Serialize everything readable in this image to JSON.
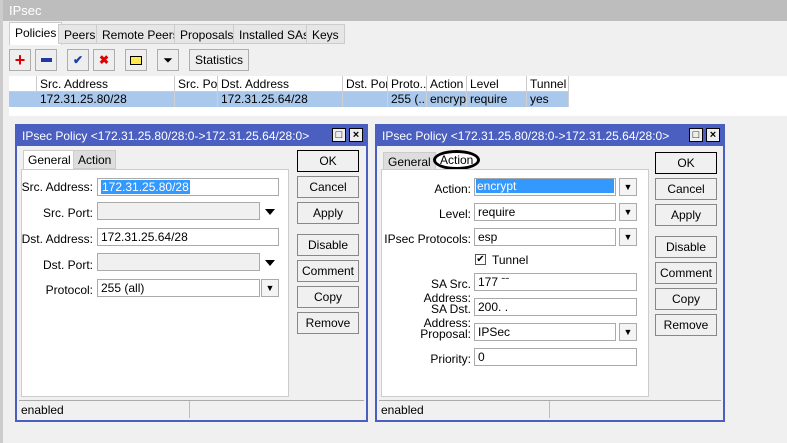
{
  "window": {
    "title": "IPsec"
  },
  "tabs": [
    "Policies",
    "Peers",
    "Remote Peers",
    "Proposals",
    "Installed SAs",
    "Keys"
  ],
  "toolbar": {
    "add": "add-icon",
    "remove": "remove-icon",
    "enable": "check-icon",
    "disable": "cross-icon",
    "comment": "note-icon",
    "filter": "filter-icon",
    "statistics": "Statistics"
  },
  "table": {
    "headers": [
      "Src. Address",
      "Src. Port",
      "Dst. Address",
      "Dst. Port",
      "Proto...",
      "Action",
      "Level",
      "Tunnel"
    ],
    "rows": [
      {
        "src": "172.31.25.80/28",
        "src_port": "",
        "dst": "172.31.25.64/28",
        "dst_port": "",
        "proto": "255 (...",
        "action": "encrypt",
        "level": "require",
        "tunnel": "yes"
      }
    ]
  },
  "dialog1": {
    "title": "IPsec Policy <172.31.25.80/28:0->172.31.25.64/28:0>",
    "tabs": [
      "General",
      "Action"
    ],
    "fields": {
      "src_label": "Src. Address:",
      "src": "172.31.25.80/28",
      "srcport_label": "Src. Port:",
      "srcport": "",
      "dst_label": "Dst. Address:",
      "dst": "172.31.25.64/28",
      "dstport_label": "Dst. Port:",
      "dstport": "",
      "proto_label": "Protocol:",
      "proto": "255 (all)"
    },
    "status": "enabled"
  },
  "dialog2": {
    "title": "IPsec Policy <172.31.25.80/28:0->172.31.25.64/28:0>",
    "tabs": [
      "General",
      "Action"
    ],
    "fields": {
      "action_label": "Action:",
      "action": "encrypt",
      "level_label": "Level:",
      "level": "require",
      "proto_label": "IPsec Protocols:",
      "proto": "esp",
      "tunnel": "Tunnel",
      "sasrc_label": "SA Src. Address:",
      "sasrc": "177 ˉˉ",
      "sadst_label": "SA Dst. Address:",
      "sadst": "200. .",
      "proposal_label": "Proposal:",
      "proposal": "IPSec",
      "priority_label": "Priority:",
      "priority": "0"
    },
    "status": "enabled"
  },
  "buttons": [
    "OK",
    "Cancel",
    "Apply",
    "Disable",
    "Comment",
    "Copy",
    "Remove"
  ]
}
